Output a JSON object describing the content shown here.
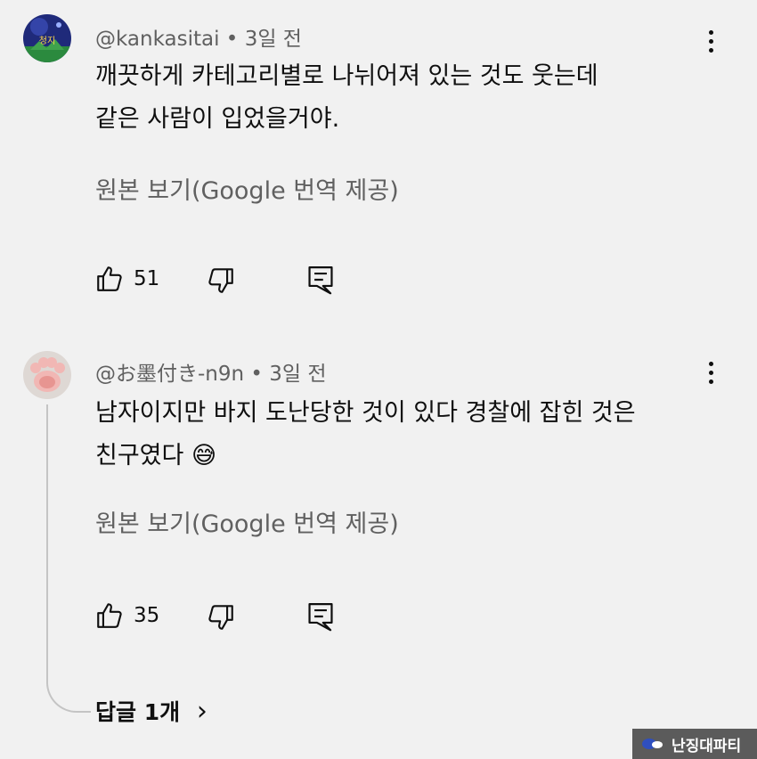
{
  "comments": [
    {
      "author": "@kankasitai",
      "dot": "•",
      "time": "3일 전",
      "lines": [
        "깨끗하게 카테고리별로 나뉘어져 있는 것도 웃는데",
        "같은 사람이 입었을거야."
      ],
      "translate_label": "원본 보기(Google 번역 제공)",
      "likes": "51",
      "avatar_text": "청지"
    },
    {
      "author": "@お墨付き-n9n",
      "dot": "•",
      "time": "3일 전",
      "lines": [
        "남자이지만 바지 도난당한 것이 있다 경찰에 잡힌 것은",
        "친구였다"
      ],
      "emoji": "😅",
      "translate_label": "원본 보기(Google 번역 제공)",
      "likes": "35"
    }
  ],
  "replies_label": "답글 1개",
  "replies_chevron": "›",
  "watermark": "난징대파티",
  "icons": [
    "like-icon",
    "dislike-icon",
    "reply-icon",
    "more-icon",
    "chevron-right-icon"
  ],
  "colors": {
    "background": "#f1f1f1",
    "text": "#0f0f0f",
    "secondary": "#606060",
    "thread": "#c4c4c4"
  }
}
